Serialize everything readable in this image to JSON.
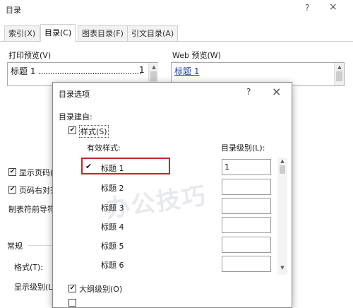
{
  "window": {
    "title": "目录",
    "help_icon": "?",
    "close_icon": "×"
  },
  "tabs": [
    {
      "label": "索引(X)",
      "active": false
    },
    {
      "label": "目录(C)",
      "active": true
    },
    {
      "label": "图表目录(F)",
      "active": false
    },
    {
      "label": "引文目录(A)",
      "active": false
    }
  ],
  "print_preview": {
    "label": "打印预览(V)",
    "line_text": "标题 1",
    "leader": "............................................",
    "page_num": "1"
  },
  "web_preview": {
    "label": "Web 预览(W)",
    "link_text": "标题 1"
  },
  "checkboxes": {
    "show_page_numbers": {
      "label": "显示页码(",
      "checked": true
    },
    "right_align": {
      "label": "页码右对齐",
      "checked": true
    }
  },
  "tab_leader_label": "制表符前导符",
  "general": {
    "heading": "常规",
    "format_label": "格式(T):",
    "show_levels_label": "显示级别(L)"
  },
  "options_dialog": {
    "title": "目录选项",
    "help_icon": "?",
    "close_icon": "×",
    "build_from_label": "目录建自:",
    "styles_checkbox": {
      "label": "样式(S)",
      "checked": true
    },
    "available_styles_header": "有效样式:",
    "toc_level_header": "目录级别(L):",
    "styles": [
      {
        "name": "标题 1",
        "checked": true,
        "level": "1"
      },
      {
        "name": "标题 2",
        "checked": false,
        "level": ""
      },
      {
        "name": "标题 3",
        "checked": false,
        "level": ""
      },
      {
        "name": "标题 4",
        "checked": false,
        "level": ""
      },
      {
        "name": "标题 5",
        "checked": false,
        "level": ""
      },
      {
        "name": "标题 6",
        "checked": false,
        "level": ""
      }
    ],
    "outline_checkbox": {
      "label": "大纲级别(O)",
      "checked": true
    },
    "watermark_text": "办公技巧"
  }
}
